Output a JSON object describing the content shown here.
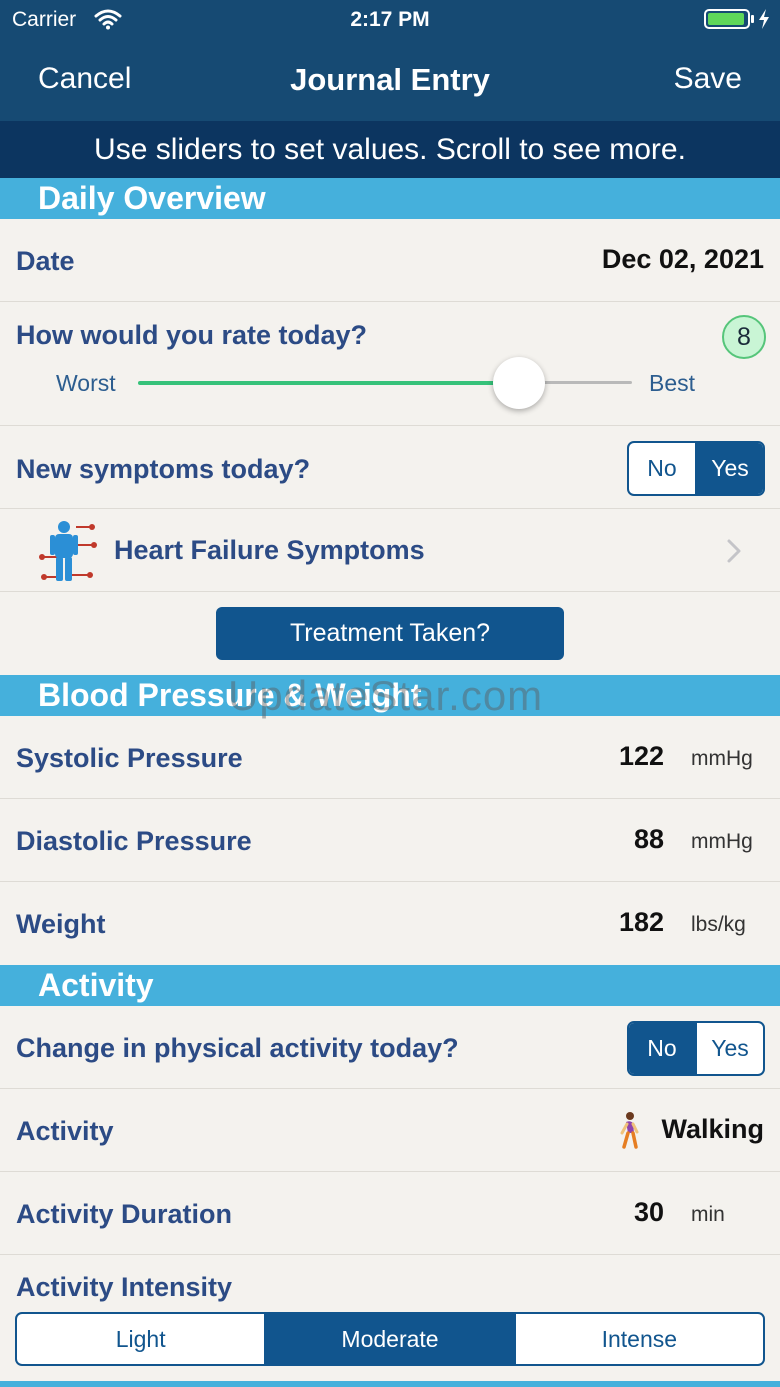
{
  "status_bar": {
    "carrier": "Carrier",
    "time": "2:17 PM"
  },
  "nav": {
    "cancel": "Cancel",
    "title": "Journal Entry",
    "save": "Save"
  },
  "banner": "Use sliders to set values. Scroll to see more.",
  "daily_overview": {
    "header": "Daily Overview",
    "date_label": "Date",
    "date_value": "Dec 02, 2021",
    "rating_question": "How would you rate today?",
    "rating_value": "8",
    "rating_fraction": 0.77,
    "slider_min_label": "Worst",
    "slider_max_label": "Best",
    "symptoms_question": "New symptoms today?",
    "symptoms_options": [
      "No",
      "Yes"
    ],
    "symptoms_selected": "Yes",
    "heart_failure_symptoms": "Heart Failure Symptoms",
    "treatment_button": "Treatment Taken?"
  },
  "blood_pressure": {
    "header": "Blood Pressure & Weight",
    "systolic_label": "Systolic Pressure",
    "systolic_value": "122",
    "systolic_unit": "mmHg",
    "diastolic_label": "Diastolic Pressure",
    "diastolic_value": "88",
    "diastolic_unit": "mmHg",
    "weight_label": "Weight",
    "weight_value": "182",
    "weight_unit": "lbs/kg"
  },
  "activity": {
    "header": "Activity",
    "change_question": "Change in physical activity today?",
    "change_options": [
      "No",
      "Yes"
    ],
    "change_selected": "No",
    "activity_label": "Activity",
    "activity_value": "Walking",
    "duration_label": "Activity Duration",
    "duration_value": "30",
    "duration_unit": "min",
    "intensity_label": "Activity Intensity",
    "intensity_options": [
      "Light",
      "Moderate",
      "Intense"
    ],
    "intensity_selected": "Moderate"
  },
  "watermark": "UpdateStar.com",
  "colors": {
    "nav_bg": "#164a73",
    "banner_bg": "#0c3560",
    "section_bg": "#45b0dc",
    "accent": "#11558e",
    "label": "#2c4b85",
    "slider_fill": "#36c27a",
    "battery": "#5fd75a"
  }
}
